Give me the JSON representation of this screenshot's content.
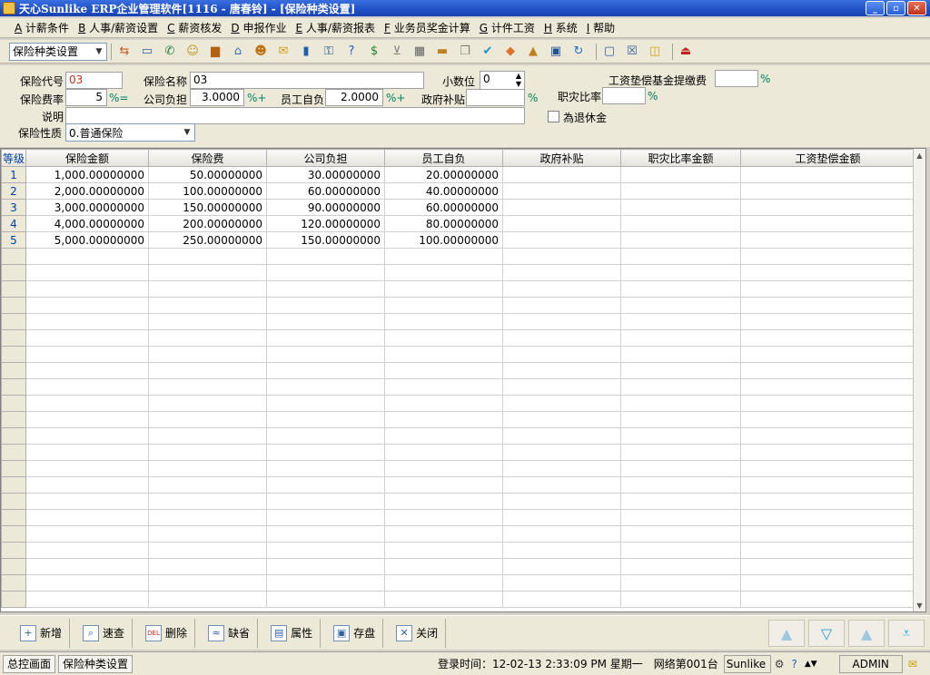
{
  "window": {
    "title": "天心Sunlike ERP企业管理软件[1116 - 唐春铃] - [保险种类设置]"
  },
  "menu": [
    {
      "key": "A",
      "label": "计薪条件"
    },
    {
      "key": "B",
      "label": "人事/薪资设置"
    },
    {
      "key": "C",
      "label": "薪资核发"
    },
    {
      "key": "D",
      "label": "申报作业"
    },
    {
      "key": "E",
      "label": "人事/薪资报表"
    },
    {
      "key": "F",
      "label": "业务员奖金计算"
    },
    {
      "key": "G",
      "label": "计件工资"
    },
    {
      "key": "H",
      "label": "系统"
    },
    {
      "key": "I",
      "label": "帮助"
    }
  ],
  "toolbar": {
    "selector_value": "保险种类设置"
  },
  "form": {
    "code_label": "保险代号",
    "code_value": "03",
    "name_label": "保险名称",
    "name_value": "03",
    "decimal_label": "小数位",
    "decimal_value": "0",
    "wage_fund_label": "工资垫偿基金提缴费",
    "wage_fund_value": "",
    "rate_label": "保险费率",
    "rate_value": "5",
    "rate_suffix": "%=",
    "company_label": "公司负担",
    "company_value": "3.0000",
    "company_suffix": "%+",
    "employee_label": "员工自负",
    "employee_value": "2.0000",
    "employee_suffix": "%+",
    "gov_label": "政府补贴",
    "gov_value": "",
    "gov_suffix": "%",
    "injury_label": "职灾比率",
    "injury_value": "",
    "injury_suffix": "%",
    "wage_fund_suffix": "%",
    "retire_label": "為退休金",
    "desc_label": "说明",
    "desc_value": "",
    "nature_label": "保险性质",
    "nature_value": "0.普通保险"
  },
  "grid": {
    "columns": [
      "等级",
      "保险金额",
      "保险费",
      "公司负担",
      "员工自负",
      "政府补贴",
      "职灾比率金额",
      "工资垫偿金额"
    ],
    "rows": [
      [
        "1",
        "1,000.00000000",
        "50.00000000",
        "30.00000000",
        "20.00000000",
        "",
        "",
        ""
      ],
      [
        "2",
        "2,000.00000000",
        "100.00000000",
        "60.00000000",
        "40.00000000",
        "",
        "",
        ""
      ],
      [
        "3",
        "3,000.00000000",
        "150.00000000",
        "90.00000000",
        "60.00000000",
        "",
        "",
        ""
      ],
      [
        "4",
        "4,000.00000000",
        "200.00000000",
        "120.00000000",
        "80.00000000",
        "",
        "",
        ""
      ],
      [
        "5",
        "5,000.00000000",
        "250.00000000",
        "150.00000000",
        "100.00000000",
        "",
        "",
        ""
      ]
    ]
  },
  "buttons": [
    {
      "name": "add",
      "label": "新增",
      "icon": "plus-icon",
      "glyph": "+"
    },
    {
      "name": "search",
      "label": "速查",
      "icon": "magnifier-icon",
      "glyph": "⌕"
    },
    {
      "name": "delete",
      "label": "删除",
      "icon": "del-icon",
      "glyph": "DEL"
    },
    {
      "name": "default",
      "label": "缺省",
      "icon": "default-icon",
      "glyph": "≈"
    },
    {
      "name": "property",
      "label": "属性",
      "icon": "property-icon",
      "glyph": "▤"
    },
    {
      "name": "save",
      "label": "存盘",
      "icon": "disk-icon",
      "glyph": "▣"
    },
    {
      "name": "close",
      "label": "关闭",
      "icon": "close-icon",
      "glyph": "✕"
    }
  ],
  "status": {
    "tab1": "总控画面",
    "tab2": "保险种类设置",
    "login": "登录时间：12-02-13 2:33:09 PM  星期一",
    "network": "网络第001台",
    "product": "Sunlike E",
    "user": "ADMIN"
  }
}
